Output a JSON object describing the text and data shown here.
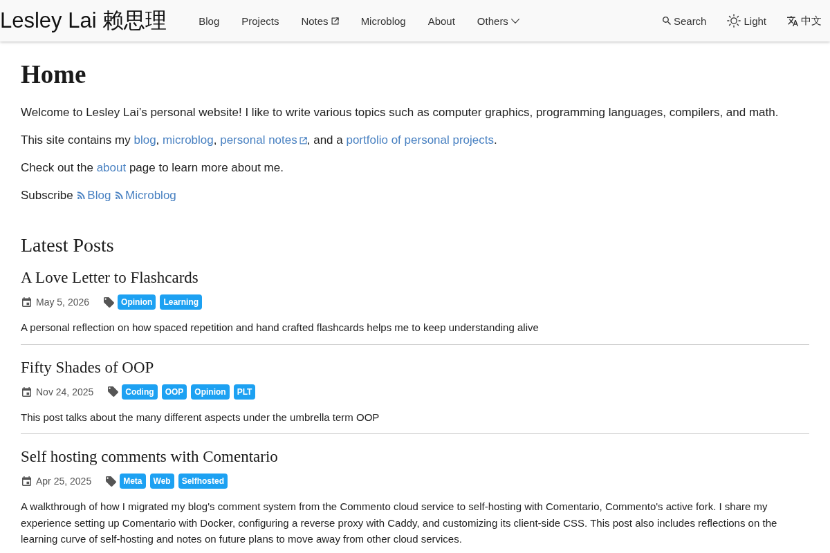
{
  "header": {
    "site_title": "Lesley Lai 赖思理",
    "nav": [
      {
        "label": "Blog",
        "kind": "link"
      },
      {
        "label": "Projects",
        "kind": "link"
      },
      {
        "label": "Notes",
        "kind": "external"
      },
      {
        "label": "Microblog",
        "kind": "link"
      },
      {
        "label": "About",
        "kind": "link"
      },
      {
        "label": "Others",
        "kind": "dropdown"
      }
    ],
    "tools": [
      {
        "label": "Search",
        "kind": "search"
      },
      {
        "label": "Light",
        "kind": "theme"
      },
      {
        "label": "中文",
        "kind": "language"
      }
    ]
  },
  "page_title": "Home",
  "intro": [
    [
      {
        "kind": "text",
        "text": "Welcome to Lesley Lai’s personal website! I like to write various topics such as computer graphics, programming languages, compilers, and math."
      }
    ],
    [
      {
        "kind": "text",
        "text": "This site contains my "
      },
      {
        "kind": "link",
        "text": "blog"
      },
      {
        "kind": "text",
        "text": ", "
      },
      {
        "kind": "link",
        "text": "microblog"
      },
      {
        "kind": "text",
        "text": ", "
      },
      {
        "kind": "external",
        "text": "personal notes"
      },
      {
        "kind": "text",
        "text": ", and a "
      },
      {
        "kind": "link",
        "text": "portfolio of personal projects"
      },
      {
        "kind": "text",
        "text": "."
      }
    ],
    [
      {
        "kind": "text",
        "text": "Check out the "
      },
      {
        "kind": "link",
        "text": "about"
      },
      {
        "kind": "text",
        "text": " page to learn more about me."
      }
    ],
    [
      {
        "kind": "text",
        "text": "Subscribe"
      },
      {
        "kind": "feed",
        "text": "Blog"
      },
      {
        "kind": "feed",
        "text": "Microblog"
      }
    ]
  ],
  "latest_posts": {
    "heading": "Latest Posts",
    "posts": [
      {
        "title": "A Love Letter to Flashcards",
        "date": "May 5, 2026",
        "tags": [
          "Opinion",
          "Learning"
        ],
        "summary": "A personal reflection on how spaced repetition and hand crafted flashcards helps me to keep understanding alive"
      },
      {
        "title": "Fifty Shades of OOP",
        "date": "Nov 24, 2025",
        "tags": [
          "Coding",
          "OOP",
          "Opinion",
          "PLT"
        ],
        "summary": "This post talks about the many different aspects under the umbrella term OOP"
      },
      {
        "title": "Self hosting comments with Comentario",
        "date": "Apr 25, 2025",
        "tags": [
          "Meta",
          "Web",
          "Selfhosted"
        ],
        "summary": "A walkthrough of how I migrated my blog's comment system from the Commento cloud service to self-hosting with Comentario, Commento's active fork. I share my experience setting up Comentario with Docker, configuring a reverse proxy with Caddy, and customizing its client-side CSS. This post also includes reflections on the learning curve of self-hosting and notes on future plans to move away from other cloud services."
      }
    ]
  }
}
